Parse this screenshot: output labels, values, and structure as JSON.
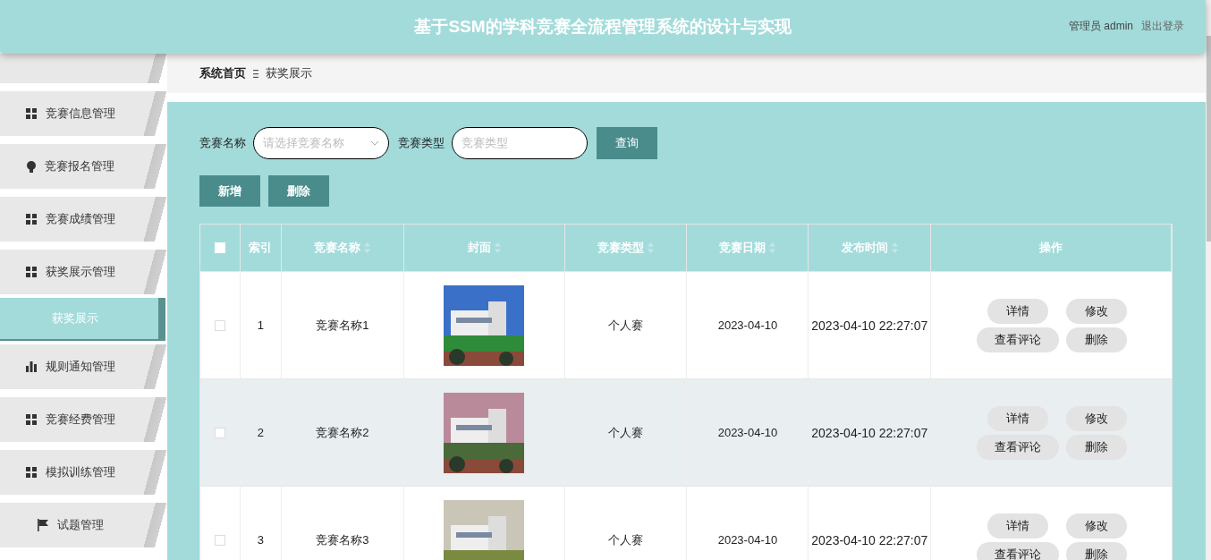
{
  "header": {
    "title": "基于SSM的学科竞赛全流程管理系统的设计与实现",
    "user": "管理员 admin",
    "logout": "退出登录"
  },
  "sidebar": {
    "items": [
      {
        "label": "竞赛信息管理",
        "kind": "grid",
        "selected": false
      },
      {
        "label": "竞赛报名管理",
        "kind": "bulb",
        "selected": false
      },
      {
        "label": "竞赛成绩管理",
        "kind": "grid",
        "selected": false
      },
      {
        "label": "获奖展示管理",
        "kind": "grid",
        "selected": false
      },
      {
        "label": "获奖展示",
        "selected": true
      },
      {
        "label": "规则通知管理",
        "kind": "bars",
        "selected": false
      },
      {
        "label": "竞赛经费管理",
        "kind": "grid",
        "selected": false
      },
      {
        "label": "模拟训练管理",
        "kind": "grid",
        "selected": false
      },
      {
        "label": "试题管理",
        "kind": "flag",
        "selected": false
      }
    ]
  },
  "breadcrumb": [
    "系统首页",
    "获奖展示"
  ],
  "search": {
    "fields": [
      {
        "label": "竞赛名称",
        "placeholder": "请选择竞赛名称",
        "kind": "select"
      },
      {
        "label": "竞赛类型",
        "placeholder": "竞赛类型",
        "kind": "text"
      }
    ],
    "button": "查询"
  },
  "actions": [
    "新增",
    "删除"
  ],
  "table": {
    "all_checked": false,
    "columns": [
      {
        "label": "索引",
        "sortable": false
      },
      {
        "label": "竞赛名称",
        "sortable": true
      },
      {
        "label": "封面",
        "sortable": true
      },
      {
        "label": "竞赛类型",
        "sortable": true
      },
      {
        "label": "竞赛日期",
        "sortable": true
      },
      {
        "label": "发布时间",
        "sortable": true
      },
      {
        "label": "操作",
        "sortable": false
      }
    ],
    "rows": [
      {
        "index": "1",
        "name": "竞赛名称1",
        "type": "个人赛",
        "date": "2023-04-10",
        "published": "2023-04-10 22:27:07",
        "checked": false,
        "buttons": [
          "详情",
          "修改",
          "查看评论",
          "删除"
        ]
      },
      {
        "index": "2",
        "name": "竞赛名称2",
        "type": "个人赛",
        "date": "2023-04-10",
        "published": "2023-04-10 22:27:07",
        "checked": false,
        "buttons": [
          "详情",
          "修改",
          "查看评论",
          "删除"
        ]
      },
      {
        "index": "3",
        "name": "竞赛名称3",
        "type": "个人赛",
        "date": "2023-04-10",
        "published": "2023-04-10 22:27:07",
        "checked": false,
        "buttons": [
          "详情",
          "修改",
          "查看评论",
          "删除"
        ]
      }
    ]
  }
}
